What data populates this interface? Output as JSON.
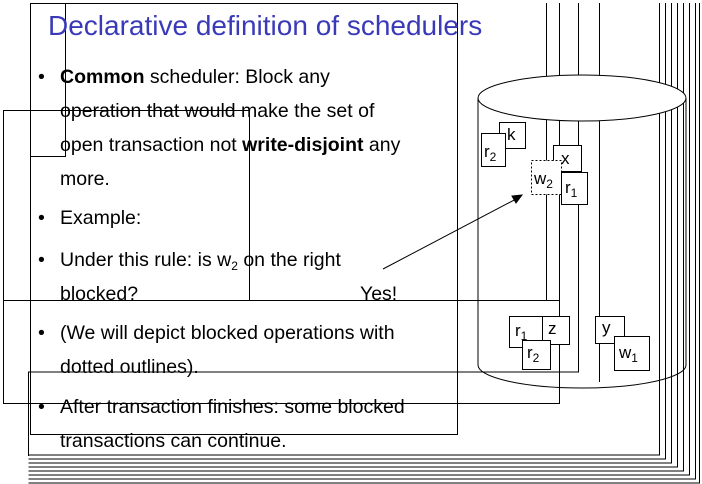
{
  "slide": {
    "title": "Declarative definition of schedulers",
    "bullet_char": "•",
    "bullets": [
      {
        "line1_bold": "Common",
        "line1_rest": " scheduler: Block any",
        "line2": "operation that would make the set of",
        "line3_pre": "open transaction not ",
        "line3_bold": "write-disjoint",
        "line3_post": " any",
        "line4": "more."
      },
      {
        "text": "Example:"
      },
      {
        "line1_pre": "Under this rule: is w",
        "line1_sub": "2",
        "line1_post": " on the right",
        "line2": "blocked?",
        "answer": "Yes!"
      },
      {
        "line1": "(We will depict blocked operations with",
        "line2": "dotted outlines)."
      },
      {
        "line1": "After transaction finishes: some blocked",
        "line2": "transactions can continue."
      }
    ]
  },
  "diagram": {
    "ops": {
      "k": "k",
      "r2_top": {
        "letter": "r",
        "sub": "2"
      },
      "x": "x",
      "w2_blocked": {
        "letter": "w",
        "sub": "2"
      },
      "r1_top": {
        "letter": "r",
        "sub": "1"
      },
      "r1_bottom": {
        "letter": "r",
        "sub": "1"
      },
      "z": "z",
      "r2_bottom": {
        "letter": "r",
        "sub": "2"
      },
      "y": "y",
      "w1": {
        "letter": "w",
        "sub": "1"
      }
    }
  }
}
